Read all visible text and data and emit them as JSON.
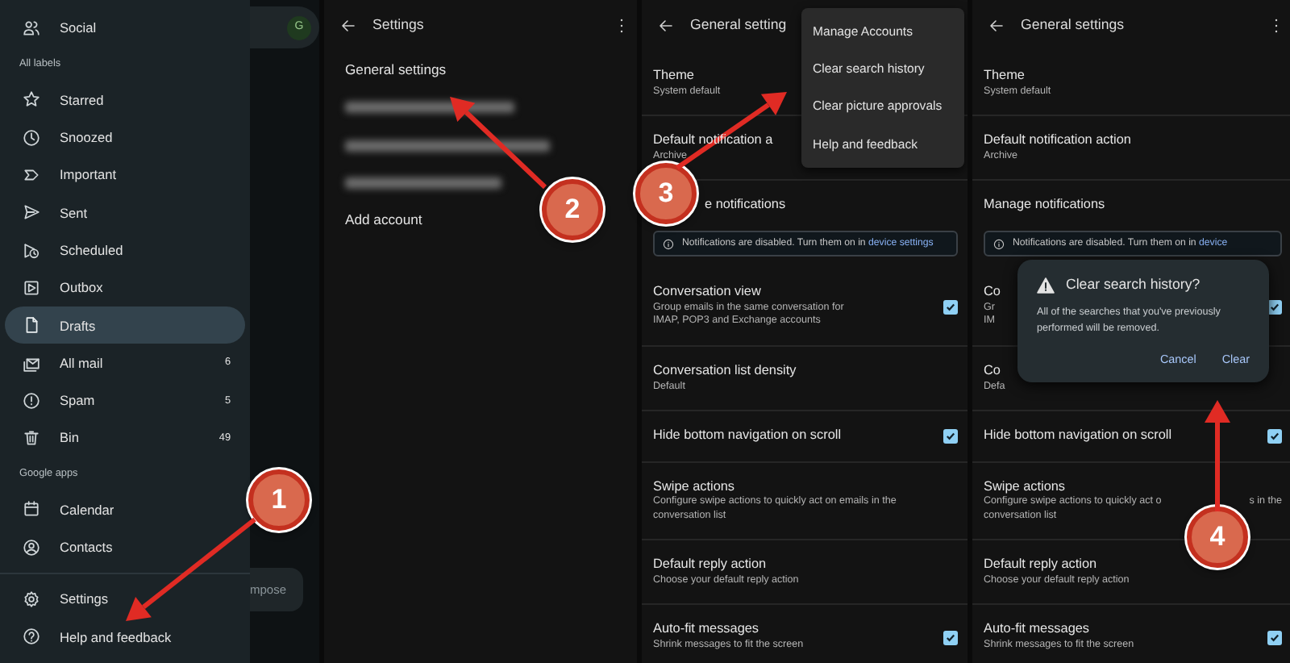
{
  "drawer_screen": {
    "items": [
      {
        "kind": "item",
        "label": "Social",
        "selected": false
      },
      {
        "kind": "header",
        "label": "All labels"
      },
      {
        "kind": "item",
        "label": "Starred",
        "selected": false
      },
      {
        "kind": "item",
        "label": "Snoozed",
        "selected": false
      },
      {
        "kind": "item",
        "label": "Important",
        "selected": false
      },
      {
        "kind": "item",
        "label": "Sent",
        "selected": false
      },
      {
        "kind": "item",
        "label": "Scheduled",
        "selected": false
      },
      {
        "kind": "item",
        "label": "Outbox",
        "selected": false
      },
      {
        "kind": "item",
        "label": "Drafts",
        "selected": true
      },
      {
        "kind": "item",
        "label": "All mail",
        "count": "6",
        "selected": false
      },
      {
        "kind": "item",
        "label": "Spam",
        "count": "5",
        "selected": false
      },
      {
        "kind": "item",
        "label": "Bin",
        "count": "49",
        "selected": false
      },
      {
        "kind": "header",
        "label": "Google apps"
      },
      {
        "kind": "item",
        "label": "Calendar",
        "selected": false
      },
      {
        "kind": "item",
        "label": "Contacts",
        "selected": false
      },
      {
        "kind": "footer",
        "label": "Settings",
        "selected": false
      },
      {
        "kind": "footer",
        "label": "Help and feedback",
        "selected": false
      }
    ],
    "avatar": "G",
    "compose_fragment": "mpose"
  },
  "settings_screen": {
    "title": "Settings",
    "items": [
      {
        "kind": "link",
        "label": "General settings"
      },
      {
        "kind": "redacted"
      },
      {
        "kind": "redacted"
      },
      {
        "kind": "redacted"
      },
      {
        "kind": "link",
        "label": "Add account"
      }
    ]
  },
  "menu_screen": {
    "title": "General setting",
    "rows": [
      {
        "kind": "setting",
        "title": "Theme",
        "lines": [
          [
            "System default"
          ]
        ]
      },
      {
        "kind": "setting",
        "title": "Default notification a",
        "lines": [
          [
            "Archive"
          ]
        ]
      },
      {
        "kind": "covered",
        "title": "e notifications"
      },
      {
        "kind": "note",
        "text": "Notifications are disabled. Turn them on in",
        "link": "device settings"
      },
      {
        "kind": "toggle",
        "title": "Conversation view",
        "lines": [
          [
            "Group emails in the same conversation for"
          ],
          [
            "IMAP, POP3 and Exchange accounts"
          ]
        ],
        "checked": true
      },
      {
        "kind": "setting",
        "title": "Conversation list density",
        "lines": [
          [
            "Default"
          ]
        ]
      },
      {
        "kind": "toggle",
        "title": "Hide bottom navigation on scroll",
        "checked": true
      },
      {
        "kind": "setting",
        "title": "Swipe actions",
        "lines": [
          [
            "Configure swipe actions to quickly act on emails in the"
          ],
          [
            "conversation list"
          ]
        ]
      },
      {
        "kind": "setting",
        "title": "Default reply action",
        "lines": [
          [
            "Choose your default reply action"
          ]
        ]
      },
      {
        "kind": "toggle",
        "title": "Auto-fit messages",
        "lines": [
          [
            "Shrink messages to fit the screen"
          ]
        ],
        "checked": true
      }
    ],
    "menu": [
      "Manage Accounts",
      "Clear search history",
      "Clear picture approvals",
      "Help and feedback"
    ]
  },
  "dialog_screen": {
    "title": "General settings",
    "rows": [
      {
        "kind": "setting",
        "title": "Theme",
        "lines": [
          [
            "System default"
          ]
        ]
      },
      {
        "kind": "setting",
        "title": "Default notification action",
        "lines": [
          [
            "Archive"
          ]
        ]
      },
      {
        "kind": "setting",
        "title": "Manage notifications"
      },
      {
        "kind": "note",
        "text": "Notifications are disabled. Turn them on in",
        "link": "device"
      },
      {
        "kind": "toggle",
        "title": "Co",
        "lines": [
          [
            "Gr"
          ],
          [
            "IM"
          ]
        ],
        "checked": true
      },
      {
        "kind": "setting",
        "title": "Co",
        "lines": [
          [
            "Defa"
          ]
        ]
      },
      {
        "kind": "toggle",
        "title": "Hide bottom navigation on scroll",
        "checked": true
      },
      {
        "kind": "setting",
        "title": "Swipe actions",
        "lines": [
          [
            "Configure swipe actions to quickly act o",
            "s in the"
          ],
          [
            "conversation list"
          ]
        ]
      },
      {
        "kind": "setting",
        "title": "Default reply action",
        "lines": [
          [
            "Choose your default reply action"
          ]
        ]
      },
      {
        "kind": "toggle",
        "title": "Auto-fit messages",
        "lines": [
          [
            "Shrink messages to fit the screen"
          ]
        ],
        "checked": true
      }
    ],
    "dialog": {
      "title": "Clear search history?",
      "message": "All of the searches that you've previously performed will be removed.",
      "buttons": [
        "Cancel",
        "Clear"
      ]
    }
  },
  "annotations": [
    {
      "label": "1"
    },
    {
      "label": "2"
    },
    {
      "label": "3"
    },
    {
      "label": "4"
    }
  ]
}
